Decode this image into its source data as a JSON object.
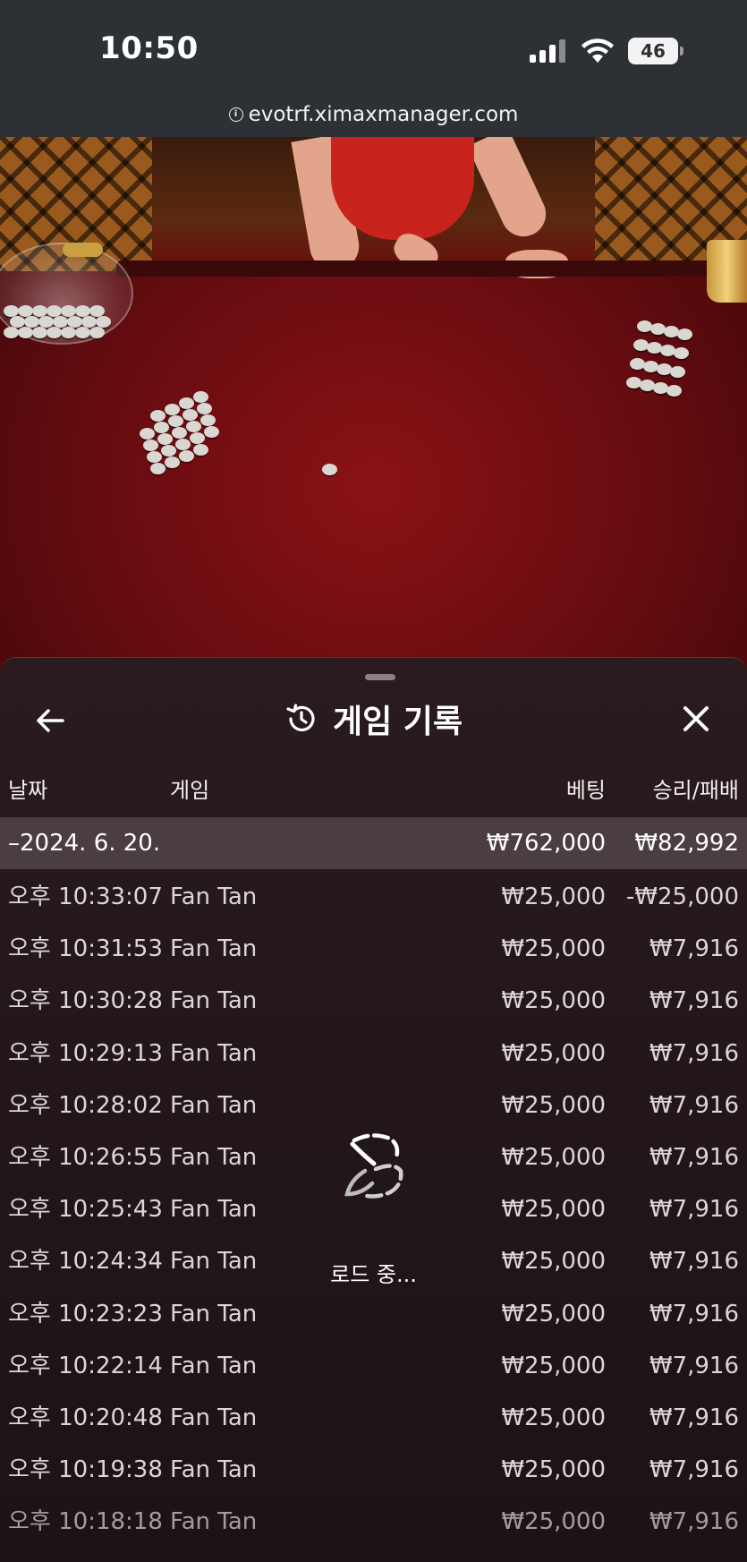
{
  "status_bar": {
    "time": "10:50",
    "battery": "46"
  },
  "browser": {
    "url": "evotrf.ximaxmanager.com"
  },
  "panel": {
    "title": "게임 기록",
    "icons": {
      "back": "back-arrow-icon",
      "history": "history-icon",
      "close": "close-icon"
    },
    "columns": {
      "date": "날짜",
      "game": "게임",
      "bet": "베팅",
      "win_loss": "승리/패배"
    },
    "summary": {
      "date": "–2024. 6. 20.",
      "bet": "₩762,000",
      "win_loss": "₩82,992"
    },
    "rows": [
      {
        "time": "오후 10:33:07",
        "game": "Fan Tan",
        "bet": "₩25,000",
        "result": "-₩25,000"
      },
      {
        "time": "오후 10:31:53",
        "game": "Fan Tan",
        "bet": "₩25,000",
        "result": "₩7,916"
      },
      {
        "time": "오후 10:30:28",
        "game": "Fan Tan",
        "bet": "₩25,000",
        "result": "₩7,916"
      },
      {
        "time": "오후 10:29:13",
        "game": "Fan Tan",
        "bet": "₩25,000",
        "result": "₩7,916"
      },
      {
        "time": "오후 10:28:02",
        "game": "Fan Tan",
        "bet": "₩25,000",
        "result": "₩7,916"
      },
      {
        "time": "오후 10:26:55",
        "game": "Fan Tan",
        "bet": "₩25,000",
        "result": "₩7,916"
      },
      {
        "time": "오후 10:25:43",
        "game": "Fan Tan",
        "bet": "₩25,000",
        "result": "₩7,916"
      },
      {
        "time": "오후 10:24:34",
        "game": "Fan Tan",
        "bet": "₩25,000",
        "result": "₩7,916"
      },
      {
        "time": "오후 10:23:23",
        "game": "Fan Tan",
        "bet": "₩25,000",
        "result": "₩7,916"
      },
      {
        "time": "오후 10:22:14",
        "game": "Fan Tan",
        "bet": "₩25,000",
        "result": "₩7,916"
      },
      {
        "time": "오후 10:20:48",
        "game": "Fan Tan",
        "bet": "₩25,000",
        "result": "₩7,916"
      },
      {
        "time": "오후 10:19:38",
        "game": "Fan Tan",
        "bet": "₩25,000",
        "result": "₩7,916"
      },
      {
        "time": "오후 10:18:18",
        "game": "Fan Tan",
        "bet": "₩25,000",
        "result": "₩7,916"
      }
    ],
    "loading_text": "로드 중..."
  }
}
